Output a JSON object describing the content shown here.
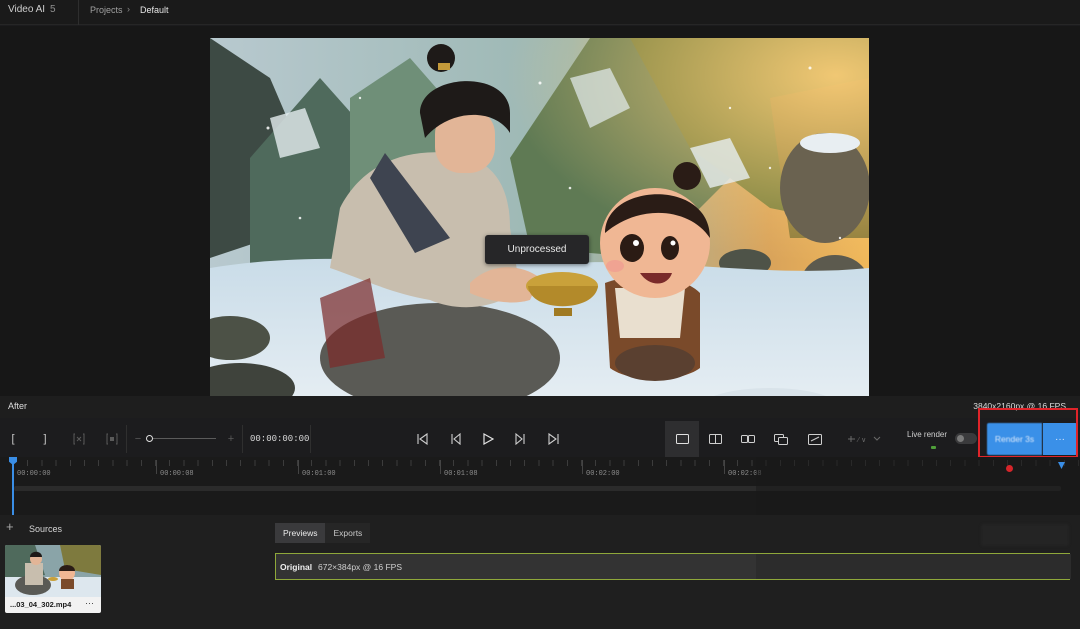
{
  "app": {
    "name": "Video AI",
    "version": "5"
  },
  "breadcrumb": {
    "parent": "Projects",
    "separator": ">",
    "current": "Default"
  },
  "preview": {
    "overlay_label": "Unprocessed",
    "mode_label": "After",
    "output_info": "3840x2160px @ 16 FPS"
  },
  "toolbar": {
    "mark_in": "[",
    "mark_out": "]",
    "zoom_out": "−",
    "zoom_in": "+",
    "zoom_level": 0.1,
    "timecode": "00:00:00:00",
    "live_render_label": "Live render",
    "live_render_on": false,
    "render_label": "Render 3s",
    "render_more": "···",
    "accent_color": "#3a90e8"
  },
  "timeline": {
    "ticks": [
      "00:00:00",
      "00:00:08",
      "00:01:00",
      "00:01:08",
      "00:02:00",
      "00:02:08"
    ],
    "playhead_color": "#3a8ee6"
  },
  "sources": {
    "label": "Sources",
    "add_icon": "plus-icon",
    "items": [
      {
        "name": "...03_04_302.mp4",
        "more": "···"
      }
    ]
  },
  "panel": {
    "tabs": [
      "Previews",
      "Exports"
    ],
    "active_tab": "Previews",
    "rows": [
      {
        "title": "Original",
        "meta": "672×384px @ 16 FPS"
      }
    ]
  }
}
